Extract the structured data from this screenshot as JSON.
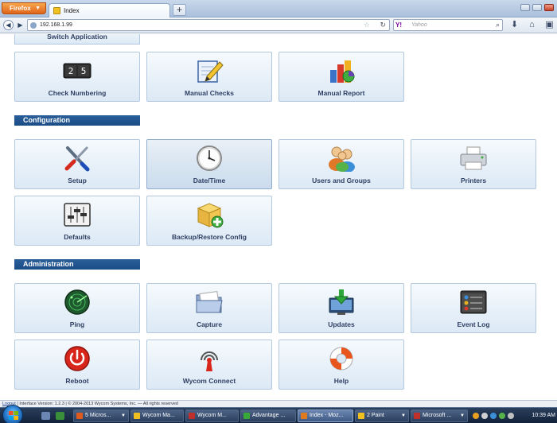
{
  "browser": {
    "app_button": "Firefox",
    "tab_title": "Index",
    "new_tab": "+",
    "url": "192.168.1.99",
    "search_placeholder": "Yahoo",
    "search_engine_logo": "Y!"
  },
  "page": {
    "partial_tile": {
      "label": "Switch Application"
    },
    "top_tiles": [
      {
        "label": "Check Numbering",
        "icon": "check-numbering-icon"
      },
      {
        "label": "Manual Checks",
        "icon": "manual-checks-icon"
      },
      {
        "label": "Manual Report",
        "icon": "manual-report-icon"
      }
    ],
    "configuration": {
      "header": "Configuration",
      "tiles": [
        {
          "label": "Setup",
          "icon": "tools-icon"
        },
        {
          "label": "Date/Time",
          "icon": "clock-icon",
          "active": true
        },
        {
          "label": "Users and Groups",
          "icon": "users-icon"
        },
        {
          "label": "Printers",
          "icon": "printer-icon"
        },
        {
          "label": "Defaults",
          "icon": "sliders-icon"
        },
        {
          "label": "Backup/Restore Config",
          "icon": "backup-box-icon"
        }
      ]
    },
    "administration": {
      "header": "Administration",
      "tiles": [
        {
          "label": "Ping",
          "icon": "radar-icon"
        },
        {
          "label": "Capture",
          "icon": "folder-icon"
        },
        {
          "label": "Updates",
          "icon": "download-icon"
        },
        {
          "label": "Event Log",
          "icon": "event-log-icon"
        },
        {
          "label": "Reboot",
          "icon": "power-icon"
        },
        {
          "label": "Wycom Connect",
          "icon": "antenna-icon"
        },
        {
          "label": "Help",
          "icon": "lifebuoy-icon"
        }
      ]
    },
    "footer": {
      "logout": "Logout",
      "version": "| Interface Version: 1.2.3 | © 2004-2013 Wycom Systems, Inc. — All rights reserved"
    }
  },
  "taskbar": {
    "items": [
      {
        "label": "5 Micros...",
        "color": "#e05a1e"
      },
      {
        "label": "Wycom Ma...",
        "color": "#f0c020"
      },
      {
        "label": "Wycom M...",
        "color": "#c0302a"
      },
      {
        "label": "Advantage ...",
        "color": "#38a838"
      },
      {
        "label": "Index - Moz...",
        "color": "#e07a1e"
      },
      {
        "label": "2 Paint",
        "color": "#f0c020"
      },
      {
        "label": "Microsoft ...",
        "color": "#c0302a"
      }
    ],
    "clock": "10:39 AM"
  }
}
